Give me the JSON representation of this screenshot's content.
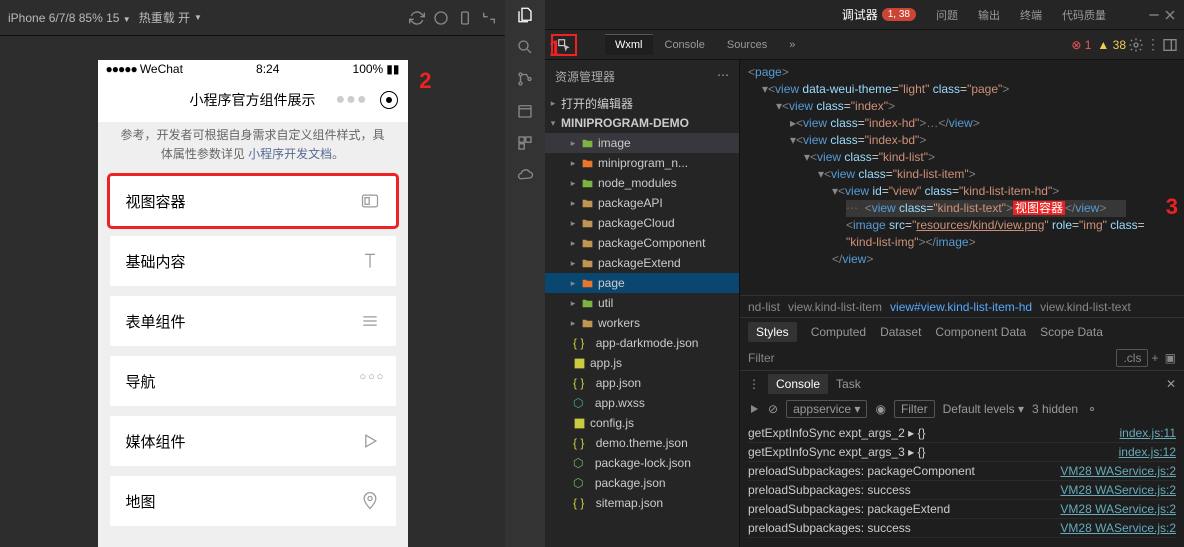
{
  "toolbar": {
    "device": "iPhone 6/7/8 85% 15",
    "reload": "热重载 开"
  },
  "phone": {
    "carrier": "WeChat",
    "time": "8:24",
    "battery": "100%",
    "title": "小程序官方组件展示",
    "desc": "参考，开发者可根据自身需求自定义组件样式，具体属性参数详见 ",
    "docLink": "小程序开发文档",
    "period": "。",
    "items": [
      "视图容器",
      "基础内容",
      "表单组件",
      "导航",
      "媒体组件",
      "地图"
    ]
  },
  "ann": {
    "one": "1",
    "two": "2",
    "three": "3"
  },
  "explorer": {
    "title": "资源管理器",
    "open": "打开的编辑器",
    "root": "MINIPROGRAM-DEMO",
    "folders": [
      "image",
      "miniprogram_n...",
      "node_modules",
      "packageAPI",
      "packageCloud",
      "packageComponent",
      "packageExtend",
      "page",
      "util",
      "workers"
    ],
    "files": [
      "app-darkmode.json",
      "app.js",
      "app.json",
      "app.wxss",
      "config.js",
      "demo.theme.json",
      "package-lock.json",
      "package.json",
      "sitemap.json"
    ]
  },
  "top": {
    "tabs": [
      "调试器",
      "问题",
      "输出",
      "终端",
      "代码质量"
    ],
    "count": "1, 38",
    "err": "1",
    "warn": "38"
  },
  "devtabs": [
    "Wxml",
    "Console",
    "Sources"
  ],
  "wxml": {
    "page": "page",
    "lines": [
      {
        "tag": "view",
        "attrs": "data-weui-theme=\"light\" class=\"page\""
      },
      {
        "tag": "view",
        "attrs": "class=\"index\""
      },
      {
        "tag": "view",
        "attrs": "class=\"index-hd\"",
        "close": true
      },
      {
        "tag": "view",
        "attrs": "class=\"index-bd\""
      },
      {
        "tag": "view",
        "attrs": "class=\"kind-list\""
      },
      {
        "tag": "view",
        "attrs": "class=\"kind-list-item\""
      },
      {
        "tag": "view",
        "attrs": "id=\"view\" class=\"kind-list-item-hd\""
      }
    ],
    "sel": {
      "tag": "view",
      "cls": "kind-list-text",
      "txt": "视图容器"
    },
    "img": {
      "tag": "image",
      "src": "resources/kind/view.png",
      "role": "img",
      "cls2": "kind-list-img"
    }
  },
  "crumbs": [
    "nd-list",
    "view.kind-list-item",
    "view#view.kind-list-item-hd",
    "view.kind-list-text"
  ],
  "styles": {
    "tabs": [
      "Styles",
      "Computed",
      "Dataset",
      "Component Data",
      "Scope Data"
    ],
    "filter": "Filter",
    "cls": ".cls"
  },
  "console": {
    "tabs": [
      "Console",
      "Task"
    ],
    "ctx": "appservice",
    "filter": "Filter",
    "levels": "Default levels",
    "hidden": "3 hidden",
    "rows": [
      {
        "m": "getExptInfoSync expt_args_2 ▸ {}",
        "s": "index.js:11"
      },
      {
        "m": "getExptInfoSync expt_args_3 ▸ {}",
        "s": "index.js:12"
      },
      {
        "m": "preloadSubpackages: packageComponent",
        "s": "VM28 WAService.js:2"
      },
      {
        "m": "preloadSubpackages: success",
        "s": "VM28 WAService.js:2"
      },
      {
        "m": "preloadSubpackages: packageExtend",
        "s": "VM28 WAService.js:2"
      },
      {
        "m": "preloadSubpackages: success",
        "s": "VM28 WAService.js:2"
      }
    ]
  }
}
